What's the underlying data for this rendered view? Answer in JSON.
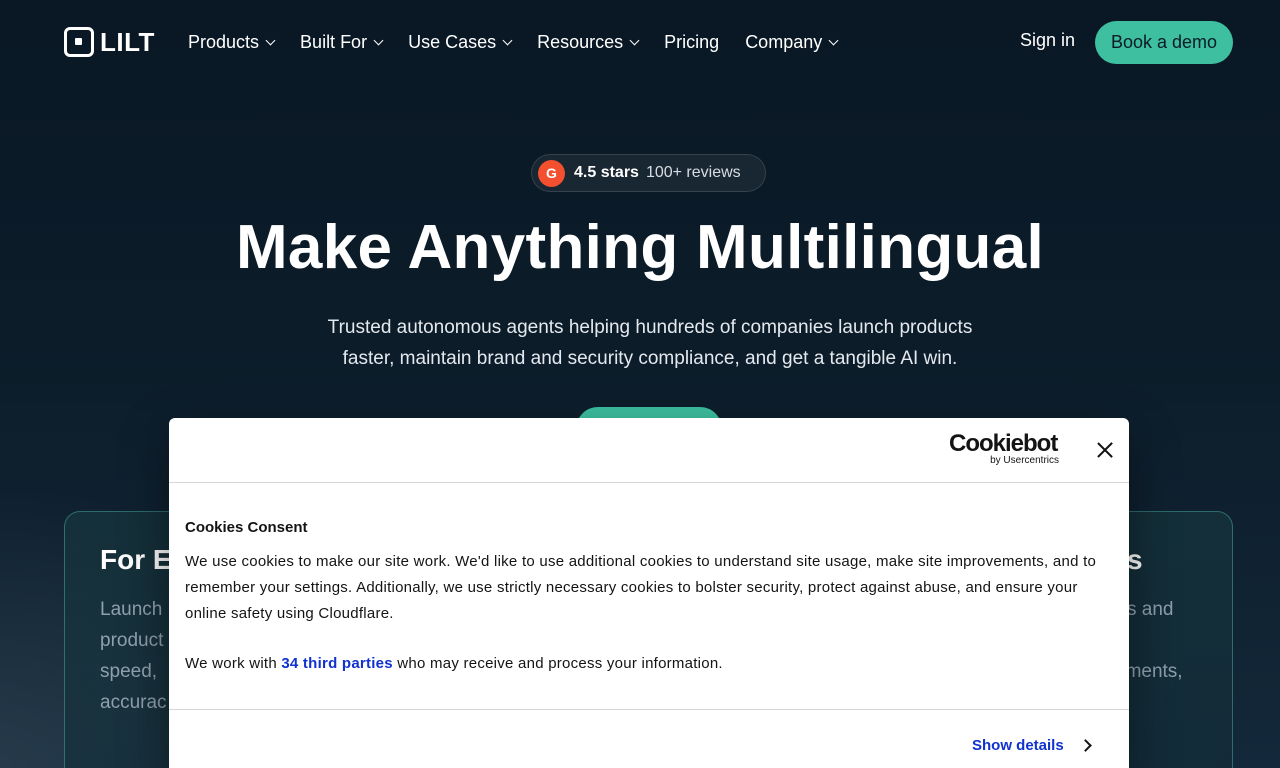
{
  "brand": {
    "name": "LILT",
    "accent": "#3dbfa0",
    "background": "#0b1a27"
  },
  "nav": {
    "items": [
      {
        "label": "Products",
        "has_dropdown": true
      },
      {
        "label": "Built For",
        "has_dropdown": true
      },
      {
        "label": "Use Cases",
        "has_dropdown": true
      },
      {
        "label": "Resources",
        "has_dropdown": true
      },
      {
        "label": "Pricing",
        "has_dropdown": false
      },
      {
        "label": "Company",
        "has_dropdown": true
      }
    ],
    "sign_in": "Sign in",
    "book_demo": "Book a demo"
  },
  "hero": {
    "rating_badge": {
      "icon": "G",
      "stars": "4.5 stars",
      "reviews": "100+ reviews"
    },
    "title": "Make Anything Multilingual",
    "subtitle_line1": "Trusted autonomous agents helping hundreds of companies launch products",
    "subtitle_line2": "faster, maintain brand and security compliance, and get a tangible AI win."
  },
  "cards": {
    "left": {
      "title": "For E",
      "lines": [
        "Launch",
        "product",
        "speed,",
        "accurac"
      ]
    },
    "right": {
      "title": "s",
      "lines": [
        "s and",
        "",
        "ements,",
        ""
      ]
    }
  },
  "cookie_modal": {
    "logo": "Cookiebot",
    "logo_sub": "by Usercentrics",
    "title": "Cookies Consent",
    "body": "We use cookies to make our site work. We'd like to use additional cookies to understand site usage, make site improvements, and to remember your settings. Additionally, we use strictly necessary cookies to bolster security, protect against abuse, and ensure your online safety using Cloudflare.",
    "third_party_prefix": "We work with ",
    "third_party_link": "34 third parties",
    "third_party_suffix": " who may receive and process your information.",
    "show_details": "Show details",
    "link_color": "#1032cf"
  }
}
